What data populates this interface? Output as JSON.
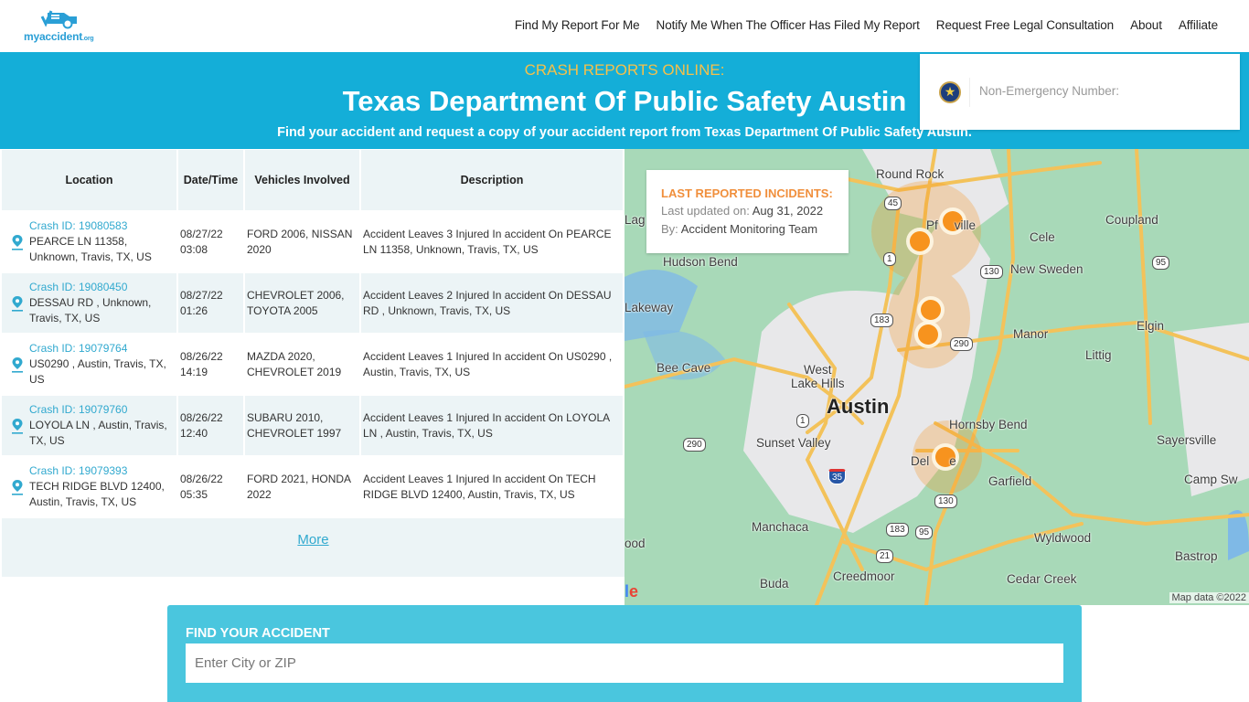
{
  "header": {
    "logo_text": "myaccident",
    "logo_tld": ".org",
    "nav": [
      {
        "label": "Find My Report For Me"
      },
      {
        "label": "Notify Me When The Officer Has Filed My Report"
      },
      {
        "label": "Request Free Legal Consultation"
      },
      {
        "label": "About"
      },
      {
        "label": "Affiliate"
      }
    ]
  },
  "banner": {
    "kicker": "CRASH REPORTS ONLINE:",
    "title": "Texas Department Of Public Safety Austin",
    "subtitle": "Find your accident and request a copy of your accident report from Texas Department Of Public Safety Austin."
  },
  "non_emergency": {
    "icon": "texas-dps-seal-icon",
    "label": "Non-Emergency Number:"
  },
  "table": {
    "columns": [
      "Location",
      "Date/Time",
      "Vehicles Involved",
      "Description"
    ],
    "rows": [
      {
        "crash_id": "Crash ID: 19080583",
        "location": "PEARCE LN 11358, Unknown, Travis, TX, US",
        "date": "08/27/22",
        "time": "03:08",
        "vehicles": "FORD 2006, NISSAN 2020",
        "description": "Accident Leaves 3 Injured In accident On PEARCE LN 11358, Unknown, Travis, TX, US"
      },
      {
        "crash_id": "Crash ID: 19080450",
        "location": "DESSAU RD , Unknown, Travis, TX, US",
        "date": "08/27/22",
        "time": "01:26",
        "vehicles": "CHEVROLET 2006, TOYOTA 2005",
        "description": "Accident Leaves 2 Injured In accident On DESSAU RD , Unknown, Travis, TX, US"
      },
      {
        "crash_id": "Crash ID: 19079764",
        "location": "US0290 , Austin, Travis, TX, US",
        "date": "08/26/22",
        "time": "14:19",
        "vehicles": "MAZDA 2020, CHEVROLET 2019",
        "description": "Accident Leaves 1 Injured In accident On US0290 , Austin, Travis, TX, US"
      },
      {
        "crash_id": "Crash ID: 19079760",
        "location": "LOYOLA LN , Austin, Travis, TX, US",
        "date": "08/26/22",
        "time": "12:40",
        "vehicles": "SUBARU 2010, CHEVROLET 1997",
        "description": "Accident Leaves 1 Injured In accident On LOYOLA LN , Austin, Travis, TX, US"
      },
      {
        "crash_id": "Crash ID: 19079393",
        "location": "TECH RIDGE BLVD 12400, Austin, Travis, TX, US",
        "date": "08/26/22",
        "time": "05:35",
        "vehicles": "FORD 2021, HONDA 2022",
        "description": "Accident Leaves 1 Injured In accident On TECH RIDGE BLVD 12400, Austin, Travis, TX, US"
      }
    ],
    "more_label": "More"
  },
  "incidents_card": {
    "title": "LAST REPORTED INCIDENTS:",
    "updated_label": "Last updated on:",
    "updated_value": "Aug 31, 2022",
    "by_label": "By:",
    "by_value": "Accident Monitoring Team"
  },
  "map": {
    "places": [
      "Round Rock",
      "Pflugerville",
      "Coupland",
      "Cele",
      "New Sweden",
      "Hudson Bend",
      "Lakeway",
      "Lago Vista",
      "Manor",
      "Elgin",
      "Littig",
      "Bee Cave",
      "West Lake Hills",
      "Austin",
      "Hornsby Bend",
      "Sayersville",
      "Sunset Valley",
      "Del Valle",
      "Garfield",
      "Camp Swift",
      "Manchaca",
      "Wyldwood",
      "Driftwood",
      "Bastrop",
      "Creedmoor",
      "Buda",
      "Cedar Creek"
    ],
    "shields": [
      "45",
      "1",
      "130",
      "95",
      "183",
      "290",
      "1",
      "290",
      "35",
      "130",
      "183",
      "95",
      "21"
    ],
    "attribution": "Map data ©2022",
    "google_fragment": "le"
  },
  "find": {
    "title": "FIND YOUR ACCIDENT",
    "placeholder": "Enter City or ZIP",
    "value": ""
  },
  "colors": {
    "brand": "#14aed8",
    "accent_orange": "#f08f3c",
    "kicker": "#f5c04a",
    "link": "#31a9cf",
    "marker": "#f7931e"
  }
}
